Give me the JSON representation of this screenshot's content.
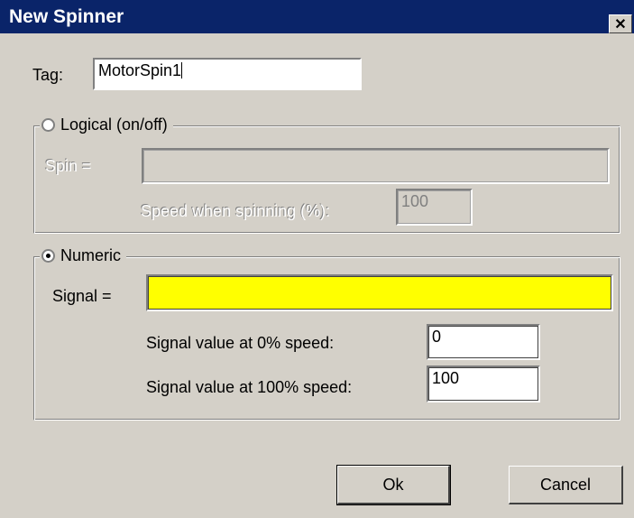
{
  "window": {
    "title": "New Spinner",
    "close_glyph": "✕"
  },
  "tag": {
    "label": "Tag:",
    "value": "MotorSpin1"
  },
  "logical": {
    "legend": "Logical (on/off)",
    "selected": false,
    "spin_label": "Spin =",
    "spin_value": "",
    "speed_label": "Speed when spinning (%):",
    "speed_value": "100"
  },
  "numeric": {
    "legend": "Numeric",
    "selected": true,
    "signal_label": "Signal =",
    "signal_value": "",
    "signal_color": "#ffff00",
    "zero_label": "Signal value at 0% speed:",
    "zero_value": "0",
    "hundred_label": "Signal value at 100% speed:",
    "hundred_value": "100"
  },
  "buttons": {
    "ok": "Ok",
    "cancel": "Cancel"
  }
}
